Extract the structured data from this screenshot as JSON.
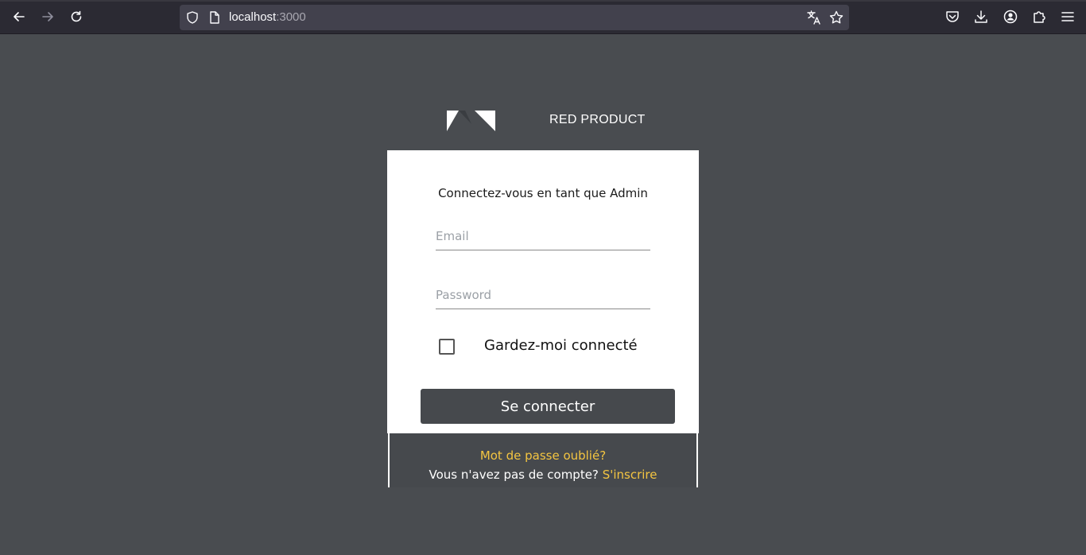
{
  "browser": {
    "url_host": "localhost",
    "url_port": ":3000"
  },
  "header": {
    "brand": "RED PRODUCT"
  },
  "login": {
    "title": "Connectez-vous en tant que Admin",
    "email_placeholder": "Email",
    "password_placeholder": "Password",
    "remember_label": "Gardez-moi connecté",
    "submit_label": "Se connecter"
  },
  "footer": {
    "forgot_label": "Mot de passe oublié?",
    "no_account_text": "Vous n'avez pas de compte?",
    "signup_label": "S'inscrire"
  },
  "colors": {
    "background": "#494c50",
    "card": "#ffffff",
    "button": "#46494d",
    "link": "#f4c541"
  }
}
